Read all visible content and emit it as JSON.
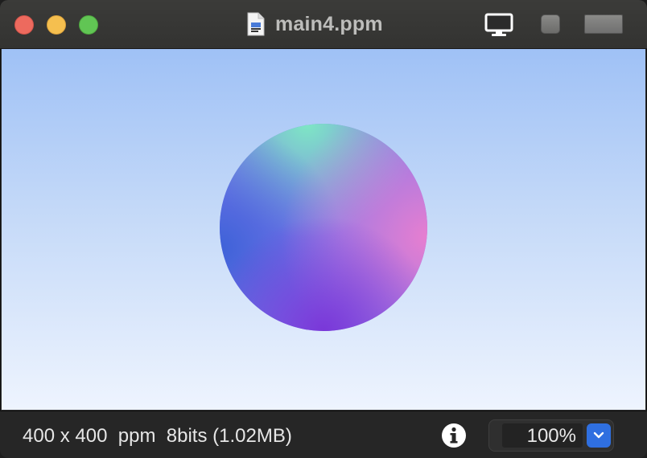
{
  "window": {
    "title": "main4.ppm",
    "colors": {
      "close": "#ed6a5e",
      "minimize": "#f5bf4f",
      "zoom": "#61c554",
      "accent": "#2f6fe0"
    }
  },
  "titlebar": {
    "file_icon": "document-icon",
    "monitor_icon": "monitor-icon"
  },
  "status": {
    "info_text": "400 x 400  ppm  8bits (1.02MB)",
    "info_icon": "info-icon",
    "zoom_value": "100%",
    "zoom_dropdown_icon": "chevron-down-icon"
  }
}
